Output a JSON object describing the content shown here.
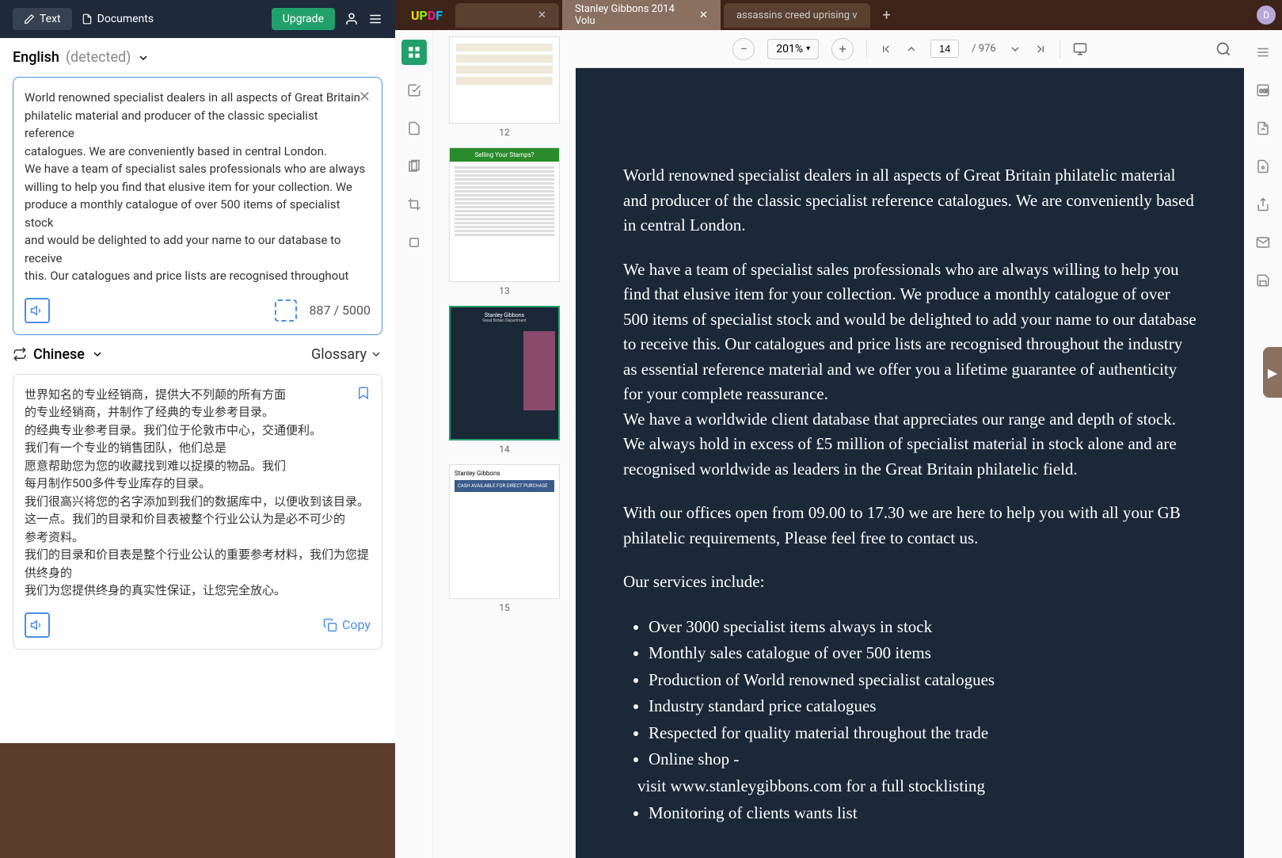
{
  "translator": {
    "header": {
      "text_btn": "Text",
      "documents_btn": "Documents",
      "upgrade_btn": "Upgrade"
    },
    "source_lang": "English",
    "detected_label": "(detected)",
    "source_text": "World renowned specialist dealers in all aspects of Great Britain\nphilatelic material and producer of the classic specialist reference\ncatalogues. We are conveniently based in central London.\nWe have a team of specialist sales professionals who are always\nwilling to help you find that elusive item for your collection. We\nproduce a monthly catalogue of over 500 items of specialist stock\nand would be delighted to add your name to our database to receive\nthis. Our catalogues and price lists are recognised throughout",
    "char_count": "887 / 5000",
    "target_lang": "Chinese",
    "glossary_label": "Glossary",
    "output_text": "世界知名的专业经销商，提供大不列颠的所有方面\n的专业经销商，并制作了经典的专业参考目录。\n的经典专业参考目录。我们位于伦敦市中心，交通便利。\n我们有一个专业的销售团队，他们总是\n愿意帮助您为您的收藏找到难以捉摸的物品。我们\n每月制作500多件专业库存的目录。\n我们很高兴将您的名字添加到我们的数据库中，以便收到该目录。\n这一点。我们的目录和价目表被整个行业公认为是必不可少的\n参考资料。\n我们的目录和价目表是整个行业公认的重要参考材料，我们为您提供终身的\n我们为您提供终身的真实性保证，让您完全放心。",
    "copy_label": "Copy"
  },
  "pdf": {
    "logo": "UPDF",
    "tabs": [
      {
        "label": "",
        "active": false
      },
      {
        "label": "Stanley Gibbons 2014 Volu",
        "active": true
      },
      {
        "label": "assassins creed uprising v",
        "active": false
      }
    ],
    "avatar": "D",
    "toolbar": {
      "zoom": "201%",
      "page_current": "14",
      "page_total": "976"
    },
    "thumbs": [
      {
        "num": "12"
      },
      {
        "num": "13",
        "header": "Selling Your Stamps?"
      },
      {
        "num": "14",
        "title": "Stanley Gibbons",
        "subtitle": "Great Britain Department"
      },
      {
        "num": "15",
        "title": "Stanley Gibbons",
        "blue": "CASH AVAILABLE FOR DIRECT PURCHASE"
      }
    ],
    "page": {
      "p1": "World renowned specialist dealers in all aspects of Great Britain philatelic material and producer of the classic specialist reference catalogues. We are conveniently based in central London.",
      "p2": "We have a team of specialist sales professionals who are always willing to help you find that elusive item for your collection. We produce a monthly catalogue of over 500 items of specialist stock and would be delighted to add your name to our database to receive this. Our catalogues and price lists are recognised throughout the industry as essential reference material and we offer you a lifetime guarantee of authenticity for your complete reassurance.\nWe have a worldwide client database that appreciates our range and depth of stock. We always hold in excess of £5 million of specialist material in stock alone and are recognised worldwide as leaders in the Great Britain philatelic field.",
      "p3": "With our offices open from 09.00 to 17.30 we are here to help you with all your GB philatelic requirements, Please feel free to contact us.",
      "p4": "Our services include:",
      "bullets": [
        "Over 3000 specialist items always in stock",
        "Monthly sales catalogue of over 500 items",
        "Production of World renowned specialist catalogues",
        "Industry standard price catalogues",
        "Respected for quality material throughout the trade",
        "Online shop -",
        "visit www.stanleygibbons.com for a full stocklisting",
        "Monitoring of clients wants list"
      ]
    }
  }
}
